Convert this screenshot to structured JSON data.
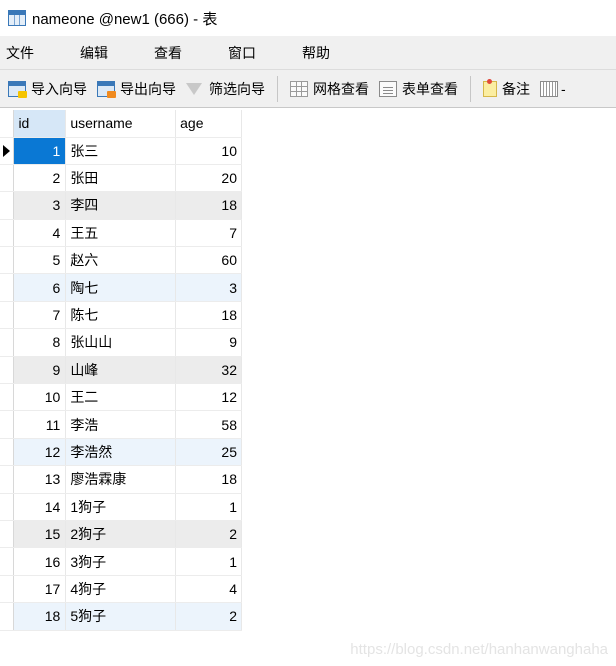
{
  "window": {
    "title": "nameone @new1 (666) - 表",
    "icon": "table-icon"
  },
  "menubar": {
    "items": [
      {
        "label": "文件"
      },
      {
        "label": "编辑"
      },
      {
        "label": "查看"
      },
      {
        "label": "窗口"
      },
      {
        "label": "帮助"
      }
    ]
  },
  "toolbar": {
    "import_wizard": {
      "label": "导入向导",
      "icon": "import-icon"
    },
    "export_wizard": {
      "label": "导出向导",
      "icon": "export-icon"
    },
    "filter_wizard": {
      "label": "筛选向导",
      "icon": "filter-icon"
    },
    "grid_view": {
      "label": "网格查看",
      "icon": "grid-view-icon"
    },
    "form_view": {
      "label": "表单查看",
      "icon": "form-view-icon"
    },
    "note": {
      "label": "备注",
      "icon": "note-icon"
    },
    "more": {
      "label": "-",
      "icon": "calendar-icon"
    }
  },
  "grid": {
    "columns": [
      "id",
      "username",
      "age"
    ],
    "selected_row": 0,
    "rows": [
      {
        "id": "1",
        "username": "张三",
        "age": "10"
      },
      {
        "id": "2",
        "username": "张田",
        "age": "20"
      },
      {
        "id": "3",
        "username": "李四",
        "age": "18"
      },
      {
        "id": "4",
        "username": "王五",
        "age": "7"
      },
      {
        "id": "5",
        "username": "赵六",
        "age": "60"
      },
      {
        "id": "6",
        "username": "陶七",
        "age": "3"
      },
      {
        "id": "7",
        "username": "陈七",
        "age": "18"
      },
      {
        "id": "8",
        "username": "张山山",
        "age": "9"
      },
      {
        "id": "9",
        "username": "山峰",
        "age": "32"
      },
      {
        "id": "10",
        "username": "王二",
        "age": "12"
      },
      {
        "id": "11",
        "username": "李浩",
        "age": "58"
      },
      {
        "id": "12",
        "username": "李浩然",
        "age": "25"
      },
      {
        "id": "13",
        "username": "廖浩霖康",
        "age": "18"
      },
      {
        "id": "14",
        "username": "1狗子",
        "age": "1"
      },
      {
        "id": "15",
        "username": "2狗子",
        "age": "2"
      },
      {
        "id": "16",
        "username": "3狗子",
        "age": "1"
      },
      {
        "id": "17",
        "username": "4狗子",
        "age": "4"
      },
      {
        "id": "18",
        "username": "5狗子",
        "age": "2"
      }
    ]
  },
  "watermark": "https://blog.csdn.net/hanhanwanghaha",
  "colors": {
    "selection": "#0a78d4",
    "header_active": "#d6e7f7",
    "row_alt": "#ececec",
    "row_highlight": "#ecf4fc"
  }
}
